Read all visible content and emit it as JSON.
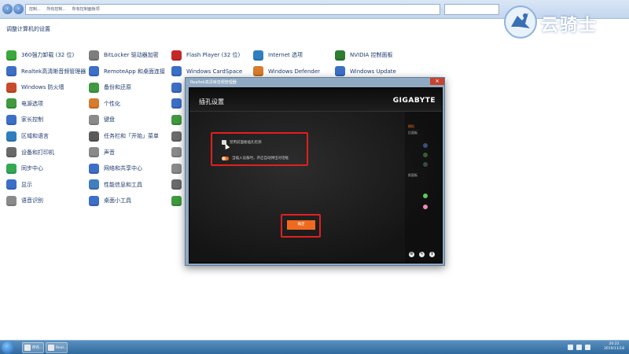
{
  "address": {
    "crumbs": [
      "控制...",
      "所有控制...",
      "所有控制面板项"
    ],
    "search_placeholder": ""
  },
  "header": {
    "title": "调整计算机的设置"
  },
  "items": [
    [
      "360强力卸载 (32 位)",
      "Realtek高清晰音频管理器",
      "Windows 防火墙",
      "电源选项",
      "家长控制",
      "区域和语言",
      "设备和打印机",
      "同步中心",
      "显示",
      "语音识别"
    ],
    [
      "BitLocker 驱动器加密",
      "RemoteApp 和桌面连接",
      "备份和还原",
      "个性化",
      "键盘",
      "任务栏和「开始」菜单",
      "声音",
      "网络和共享中心",
      "性能信息和工具",
      "桌面小工具"
    ],
    [
      "Flash Player (32 位)",
      "Windows CardSpace",
      "",
      "",
      "",
      "",
      "",
      "",
      "",
      ""
    ],
    [
      "Internet 选项",
      "Windows Defender",
      "",
      "",
      "",
      "",
      "",
      "",
      "",
      ""
    ],
    [
      "NVIDIA 控制面板",
      "Windows Update",
      "",
      "",
      "",
      "",
      "",
      "",
      "",
      ""
    ]
  ],
  "colors": {
    "icons": [
      [
        "#3aa83a",
        "#3c6fc8",
        "#c94a2a",
        "#3f9a3f",
        "#3c6fc8",
        "#2f7fc0",
        "#6a6a6a",
        "#34a853",
        "#3c6fc8",
        "#8a8a8a"
      ],
      [
        "#7d7d7d",
        "#3c6fc8",
        "#3f9a3f",
        "#d77b2c",
        "#8a8a8a",
        "#5a5a5a",
        "#8a8a8a",
        "#3c6fc8",
        "#3f7fc0",
        "#3c6fc8"
      ],
      [
        "#c62828",
        "#3c6fc8",
        "#3c6fc8",
        "#3c6fc8",
        "#3f9a3f",
        "#6a6a6a",
        "#8a8a8a",
        "#8a8a8a",
        "#6a6a6a",
        "#3f9a3f"
      ],
      [
        "#2f7fc0",
        "#d77b2c"
      ],
      [
        "#2e7d32",
        "#3c6fc8"
      ]
    ],
    "accent": "#ef6a1e",
    "highlight": "#e02020"
  },
  "logo": {
    "text": "云骑士"
  },
  "dialog": {
    "window_title": "Realtek高清晰音频管理器",
    "app_title": "插孔设置",
    "brand": "GIGABYTE",
    "option1": "禁用前面板插孔检测",
    "option2": "当插入设备时，开启自动弹出对话框",
    "ok_label": "确定",
    "side_labels": [
      "模拟",
      "后面板",
      "前面板"
    ]
  },
  "taskbar": {
    "tasks": [
      "所有...",
      "Real..."
    ],
    "time": "20:22",
    "date": "2019/11/18"
  }
}
